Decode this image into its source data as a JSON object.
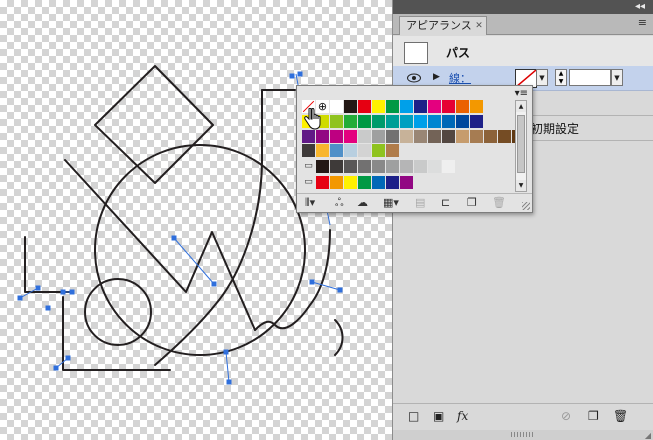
{
  "panel": {
    "tab_label": "アピアランス",
    "object_label": "パス",
    "stroke_label": "線：",
    "default_label": "初期設定"
  },
  "colors": {
    "panel_bg": "#d9d9d9",
    "selection_row": "#c3d2ec",
    "selection_handle": "#2f6fdc",
    "path_stroke": "#231f20"
  },
  "icons": {
    "eye": "eye-icon",
    "disclosure": "triangle-right-icon",
    "panel_menu": "hamburger-menu-icon",
    "add_stroke": "new-stroke-icon",
    "add_fill": "new-fill-icon",
    "fx": "fx-icon",
    "clear": "clear-appearance-icon",
    "duplicate": "duplicate-item-icon",
    "delete": "trash-icon",
    "swatch_library": "swatch-library-icon",
    "cc_library": "cc-library-icon",
    "swatch_kind": "show-swatch-kinds-icon",
    "swatch_options": "swatch-options-icon",
    "new_group": "new-color-group-icon",
    "new_swatch": "new-swatch-icon",
    "delete_swatch": "delete-swatch-icon"
  },
  "swatches": {
    "row1": [
      "none",
      "registration",
      "#ffffff",
      "#231815",
      "#e60012",
      "#fff100",
      "#009944",
      "#00a0e9",
      "#1d2088",
      "#e4007f",
      "#e60033",
      "#eb6100",
      "#f39800"
    ],
    "row2": [
      "#fff100",
      "#cfdb00",
      "#8fc31f",
      "#22ac38",
      "#009944",
      "#009b6b",
      "#009e96",
      "#00a0c1",
      "#00a0e9",
      "#0086d1",
      "#0068b7",
      "#00479d",
      "#1d2088"
    ],
    "row3": [
      "#601986",
      "#920783",
      "#be0081",
      "#e4007f",
      "#c9caca",
      "#9fa0a0",
      "#727171",
      "#c7b299",
      "#998675",
      "#736357",
      "#534741",
      "#c69c6d",
      "#a67c52"
    ],
    "row3b": [
      "#8c6239",
      "#754c24",
      "#603913"
    ],
    "row4": [
      "#3e3a39",
      "#f8b62d",
      "#4f90c8",
      "#b8cfe0",
      "#d3d3d3",
      "#8fc31f",
      "#b07c4a"
    ],
    "row5": [
      "#231815",
      "#3e3a39",
      "#595757",
      "#727171",
      "#898989",
      "#9fa0a0",
      "#b5b5b6",
      "#c9caca",
      "#dcdddd",
      "#efefef"
    ],
    "row6": [
      "#e60012",
      "#f39800",
      "#fff100",
      "#009944",
      "#0068b7",
      "#1d2088",
      "#920783"
    ]
  }
}
